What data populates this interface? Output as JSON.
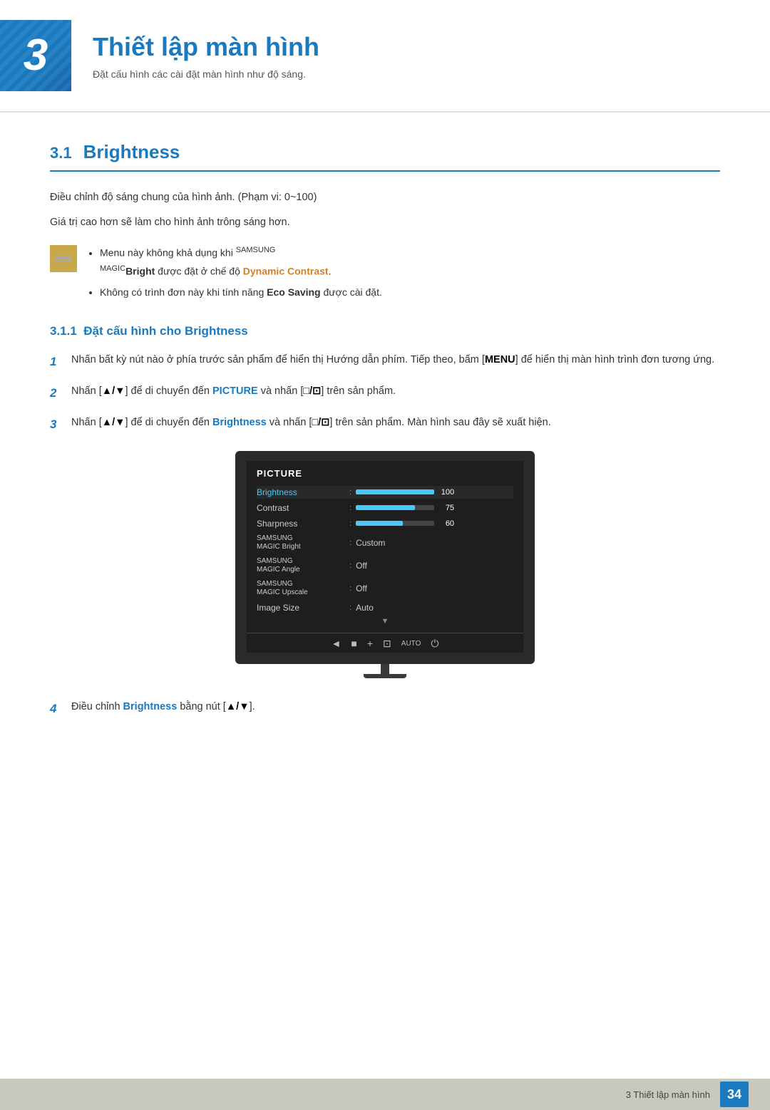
{
  "chapter": {
    "number": "3",
    "title": "Thiết lập màn hình",
    "subtitle": "Đặt cấu hình các cài đặt màn hình như độ sáng."
  },
  "section": {
    "number": "3.1",
    "title": "Brightness"
  },
  "body_paragraphs": [
    "Điều chỉnh độ sáng chung của hình ảnh. (Phạm vi: 0~100)",
    "Giá trị cao hơn sẽ làm cho hình ảnh trông sáng hơn."
  ],
  "notes": [
    "Menu này không khả dụng khi SAMSUNG MAGIC Bright được đặt ở chế độ Dynamic Contrast.",
    "Không có trình đơn này khi tính năng Eco Saving được cài đặt."
  ],
  "subsection": {
    "number": "3.1.1",
    "title": "Đặt cấu hình cho Brightness"
  },
  "steps": [
    "Nhấn bất kỳ nút nào ở phía trước sản phẩm để hiển thị Hướng dẫn phím. Tiếp theo, bấm [MENU] để hiển thị màn hình trình đơn tương ứng.",
    "Nhấn [▲/▼] để di chuyển đến PICTURE và nhấn [□/⊡] trên sản phẩm.",
    "Nhấn [▲/▼] để di chuyển đến Brightness và nhấn [□/⊡] trên sản phẩm. Màn hình sau đây sẽ xuất hiện.",
    "Điều chỉnh Brightness bằng nút [▲/▼]."
  ],
  "monitor": {
    "title": "PICTURE",
    "menu_items": [
      {
        "label": "Brightness",
        "type": "bar",
        "fill_pct": 100,
        "value": "100",
        "selected": true
      },
      {
        "label": "Contrast",
        "type": "bar",
        "fill_pct": 75,
        "value": "75",
        "selected": false
      },
      {
        "label": "Sharpness",
        "type": "bar",
        "fill_pct": 60,
        "value": "60",
        "selected": false
      },
      {
        "label": "SAMSUNG MAGIC Bright",
        "type": "text",
        "value": "Custom",
        "selected": false
      },
      {
        "label": "SAMSUNG MAGIC Angle",
        "type": "text",
        "value": "Off",
        "selected": false
      },
      {
        "label": "SAMSUNG MAGIC Upscale",
        "type": "text",
        "value": "Off",
        "selected": false
      },
      {
        "label": "Image Size",
        "type": "text",
        "value": "Auto",
        "selected": false
      }
    ],
    "bottom_icons": [
      "◄",
      "■",
      "■",
      "■",
      "AUTO",
      "⏻"
    ]
  },
  "footer": {
    "chapter_ref": "3 Thiết lập màn hình",
    "page_number": "34"
  }
}
